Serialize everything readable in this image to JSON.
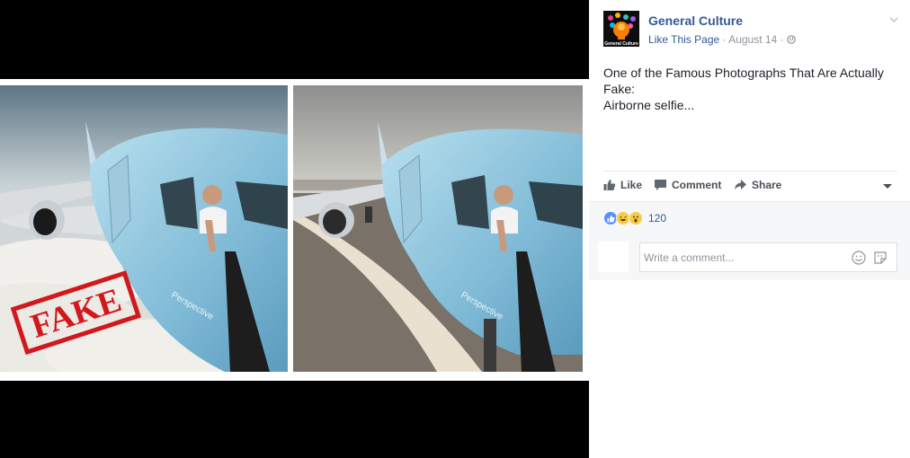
{
  "post": {
    "page_name": "General Culture",
    "like_page": "Like This Page",
    "date": "August 14",
    "separator": "·",
    "text_lines": [
      "One of the Famous Photographs That Are Actually Fake:",
      "Airborne selfie..."
    ],
    "fake_stamp": "FAKE",
    "fuselage_text": "Perspective",
    "avatar_caption": "General Culture"
  },
  "actions": {
    "like": "Like",
    "comment": "Comment",
    "share": "Share"
  },
  "reactions": {
    "types": [
      "like",
      "haha",
      "wow"
    ],
    "count": "120"
  },
  "comment_input": {
    "placeholder": "Write a comment..."
  },
  "colors": {
    "link": "#365899",
    "text": "#1d2129",
    "muted": "#90949c",
    "sky_blue": "#a9d3ea",
    "stamp_red": "#d2181c"
  }
}
